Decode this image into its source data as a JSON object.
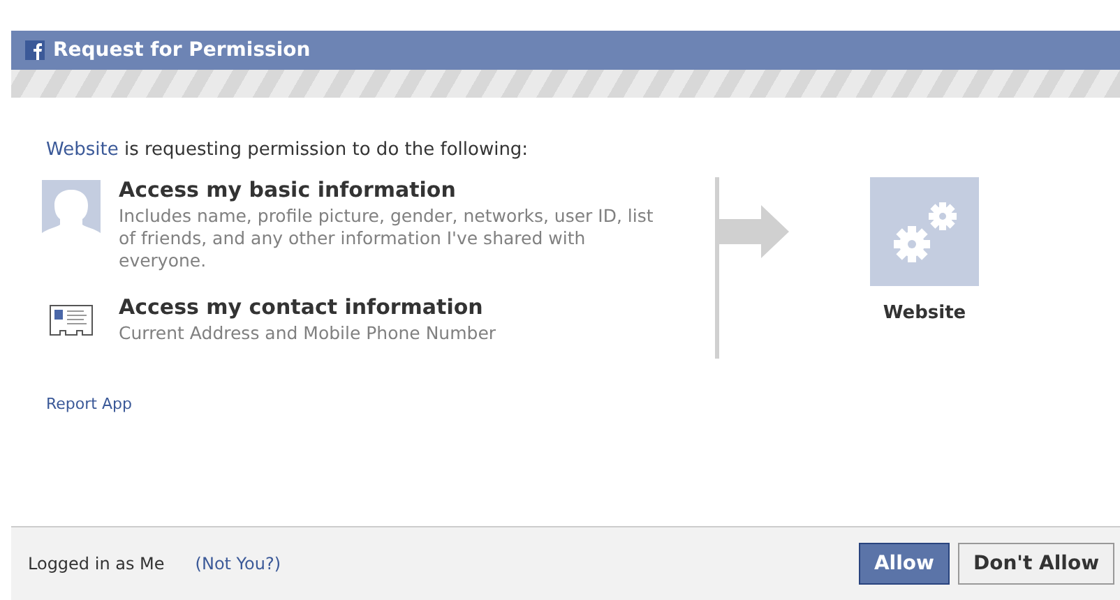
{
  "window": {
    "title": "Request for Permission"
  },
  "intro": {
    "link": "Website",
    "text": " is requesting permission to do the following:"
  },
  "permissions": [
    {
      "kind": "profile",
      "title": "Access my basic information",
      "description": "Includes name, profile picture, gender, networks, user ID, list of friends, and any other information I've shared with everyone."
    },
    {
      "kind": "contact",
      "title": "Access my contact information",
      "description": "Current Address and Mobile Phone Number"
    }
  ],
  "app": {
    "name": "Website"
  },
  "report_link": "Report App",
  "footer": {
    "logged_in": "Logged in as Me",
    "not_you": "(Not You?)",
    "buttons": [
      {
        "label": "Allow",
        "kind": "primary"
      },
      {
        "label": "Don't Allow",
        "kind": "secondary"
      }
    ]
  }
}
